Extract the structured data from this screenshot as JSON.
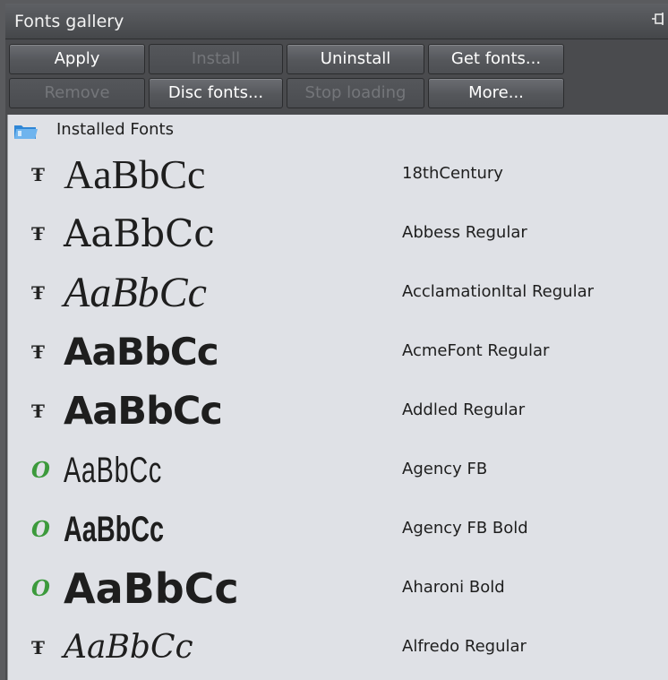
{
  "window": {
    "title": "Fonts gallery",
    "pin_icon": "pin-icon"
  },
  "toolbar": {
    "row1": [
      {
        "label": "Apply",
        "enabled": true
      },
      {
        "label": "Install",
        "enabled": false
      },
      {
        "label": "Uninstall",
        "enabled": true
      },
      {
        "label": "Get fonts...",
        "enabled": true
      }
    ],
    "row2": [
      {
        "label": "Remove",
        "enabled": false
      },
      {
        "label": "Disc fonts...",
        "enabled": true
      },
      {
        "label": "Stop loading",
        "enabled": false
      },
      {
        "label": "More...",
        "enabled": true
      }
    ]
  },
  "gallery": {
    "group_label": "Installed Fonts",
    "group_icon": "folder-icon",
    "colors": {
      "folder": "#2e86d6",
      "opentype_icon": "#3c9a3c"
    },
    "fonts": [
      {
        "sample": "AaBbCc",
        "name": "18thCentury",
        "icon": "truetype-icon",
        "icon_glyph": "Ŧ"
      },
      {
        "sample": "AaBbCc",
        "name": "Abbess Regular",
        "icon": "truetype-icon",
        "icon_glyph": "Ŧ"
      },
      {
        "sample": "AaBbCc",
        "name": "AcclamationItal Regular",
        "icon": "truetype-icon",
        "icon_glyph": "Ŧ"
      },
      {
        "sample": "AaBbCc",
        "name": "AcmeFont Regular",
        "icon": "truetype-icon",
        "icon_glyph": "Ŧ"
      },
      {
        "sample": "AaBbCc",
        "name": "Addled Regular",
        "icon": "truetype-icon",
        "icon_glyph": "Ŧ"
      },
      {
        "sample": "AaBbCc",
        "name": "Agency FB",
        "icon": "opentype-icon",
        "icon_glyph": "O"
      },
      {
        "sample": "AaBbCc",
        "name": "Agency FB Bold",
        "icon": "opentype-icon",
        "icon_glyph": "O"
      },
      {
        "sample": "AaBbCc",
        "name": "Aharoni Bold",
        "icon": "opentype-icon",
        "icon_glyph": "O"
      },
      {
        "sample": "AaBbCc",
        "name": "Alfredo Regular",
        "icon": "truetype-icon",
        "icon_glyph": "Ŧ"
      }
    ]
  }
}
